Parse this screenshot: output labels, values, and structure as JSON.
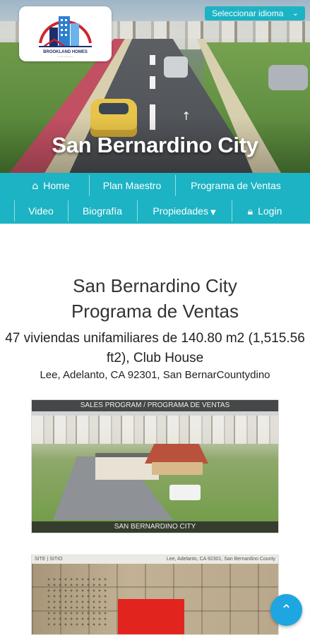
{
  "language_selector": {
    "label": "Seleccionar idioma",
    "icon": "chevron-down-icon"
  },
  "hero": {
    "title": "San Bernardino City",
    "logo": {
      "icon": "building-logo",
      "tagline": "BROOKLAND HOMES"
    }
  },
  "nav": {
    "items": [
      {
        "label": "Home",
        "icon": "home-icon"
      },
      {
        "label": "Plan Maestro"
      },
      {
        "label": "Programa de Ventas"
      },
      {
        "label": "Video"
      },
      {
        "label": "Biografía"
      },
      {
        "label": "Propiedades",
        "icon": "caret-down-icon"
      },
      {
        "label": "Login",
        "icon": "lock-icon"
      }
    ],
    "color": "#1cb3c4"
  },
  "content": {
    "heading_line1": "San Bernardino City",
    "heading_line2": "Programa de Ventas",
    "description": "47 viviendas unifamiliares de 140.80 m2 (1,515.56 ft2), Club House",
    "address": "Lee, Adelanto, CA 92301, San BernarCountydino"
  },
  "render_image": {
    "top_caption": "SALES PROGRAM / PROGRAMA DE VENTAS",
    "bottom_caption": "SAN BERNARDINO CITY"
  },
  "aerial_image": {
    "left_caption": "SITE | SITIO",
    "right_caption": "Lee, Adelanto, CA 92301, San Bernardino County"
  },
  "fab": {
    "icon": "chevron-up-icon",
    "color": "#1ea6e0"
  }
}
